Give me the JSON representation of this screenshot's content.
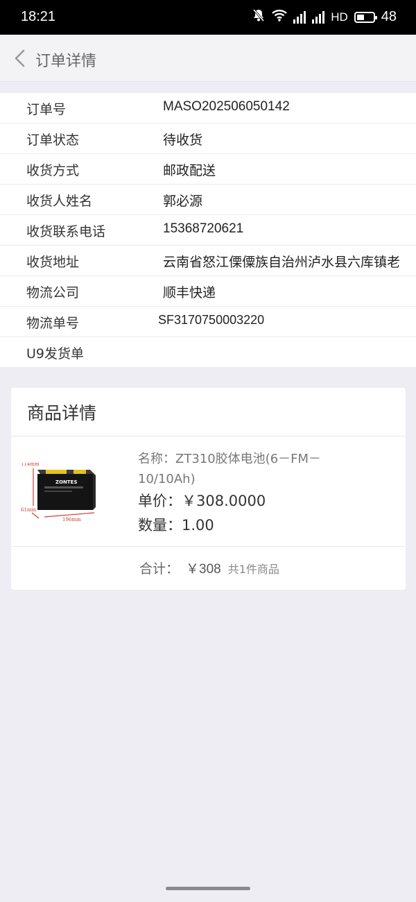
{
  "status": {
    "time": "18:21",
    "hd": "HD",
    "battery": "48"
  },
  "nav": {
    "title": "订单详情"
  },
  "order": {
    "number_label": "订单号",
    "number": "MASO202506050142",
    "status_label": "订单状态",
    "status": "待收货",
    "method_label": "收货方式",
    "method": "邮政配送",
    "name_label": "收货人姓名",
    "name": "郭必源",
    "phone_label": "收货联系电话",
    "phone": "15368720621",
    "address_label": "收货地址",
    "address": "云南省怒江傈僳族自治州泸水县六库镇老",
    "company_label": "物流公司",
    "company": "顺丰快递",
    "tracking_label": "物流单号",
    "tracking": "SF3170750003220",
    "u9_label": "U9发货单"
  },
  "goods": {
    "title": "商品详情",
    "name_line1": "名称：ZT310胶体电池(6－FM－",
    "name_line2": "10/10Ah)",
    "price": "单价：￥308.0000",
    "qty": "数量：1.00",
    "total_label": "合计：",
    "total_value": "￥308",
    "total_count": "共1件商品",
    "image": {
      "brand": "ZONTES",
      "dim_height": "114mm",
      "dim_width": "196mm",
      "dim_depth": "61mm"
    }
  },
  "colors": {
    "page_bg": "#eeedf3",
    "card_bg": "#ffffff",
    "status_bar": "#000000",
    "dimension_red": "#d23a2a"
  }
}
